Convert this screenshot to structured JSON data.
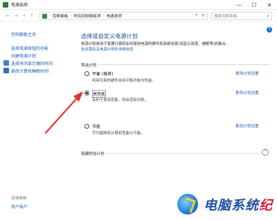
{
  "window": {
    "title": "电源选项",
    "controls": [
      "—",
      "☐",
      "✕"
    ]
  },
  "address": {
    "segments": [
      "控制面板",
      "所有控制面板项",
      "电源选项"
    ],
    "search_placeholder": "搜索控制面板"
  },
  "sidebar": {
    "items": [
      {
        "label": "控制面板主页"
      },
      {
        "label": "选择电源按钮的功能"
      },
      {
        "label": "创建电源计划"
      },
      {
        "label": "选择关闭显示器的时间"
      },
      {
        "label": "更改计算机睡眠时间"
      }
    ],
    "see_also_label": "另请参阅",
    "user_accounts": "用户帐户"
  },
  "main": {
    "title": "选择或自定义电源计划",
    "description": "电源计划是用于管理计算机如何使用电源的硬件和系统设置(如显示亮度、睡眠等)的集合。",
    "description_link": "告诉我有关电源计划的详细信息",
    "preferred_label": "首选计划",
    "hidden_label": "隐藏附加计划",
    "plans": [
      {
        "name": "平衡 (推荐)",
        "desc": "利用可用的硬件自动平衡功耗与性能。",
        "link": "更改计划设置",
        "selected": false
      },
      {
        "name": "高性能",
        "desc": "有利于提高性能，但会增加功耗。",
        "link": "更改计划设置",
        "selected": true
      },
      {
        "name": "节能",
        "desc": "尽可能降低计算机性能以节能。",
        "link": "更改计划设置",
        "selected": false
      }
    ]
  },
  "watermark": {
    "text_main": "电脑系统",
    "text_accent": "纪"
  },
  "colors": {
    "link": "#1a5fb4",
    "title": "#1a4e9c",
    "arrow": "#e8302a"
  }
}
